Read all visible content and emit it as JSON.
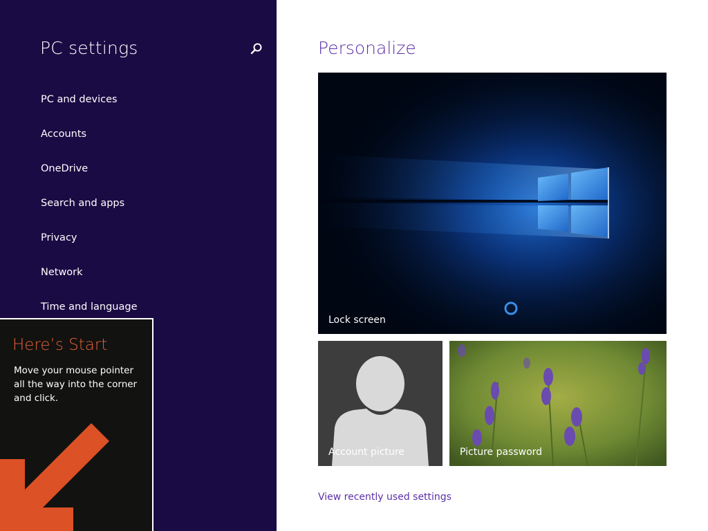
{
  "sidebar": {
    "title": "PC settings",
    "search_icon": "search-icon",
    "items": [
      {
        "label": "PC and devices"
      },
      {
        "label": "Accounts"
      },
      {
        "label": "OneDrive"
      },
      {
        "label": "Search and apps"
      },
      {
        "label": "Privacy"
      },
      {
        "label": "Network"
      },
      {
        "label": "Time and language"
      }
    ]
  },
  "main": {
    "title": "Personalize",
    "tiles": {
      "lock_screen": {
        "label": "Lock screen"
      },
      "account_picture": {
        "label": "Account picture"
      },
      "picture_password": {
        "label": "Picture password"
      }
    },
    "recent_link": "View recently used settings"
  },
  "start_tip": {
    "title": "Here’s Start",
    "body": "Move your mouse pointer all the way into the corner and click.",
    "arrow_icon": "arrow-down-left-icon"
  },
  "colors": {
    "sidebar_bg": "#1b0b44",
    "accent": "#5b2fa8",
    "tip_title": "#e0603a",
    "tip_bg": "#121210"
  }
}
